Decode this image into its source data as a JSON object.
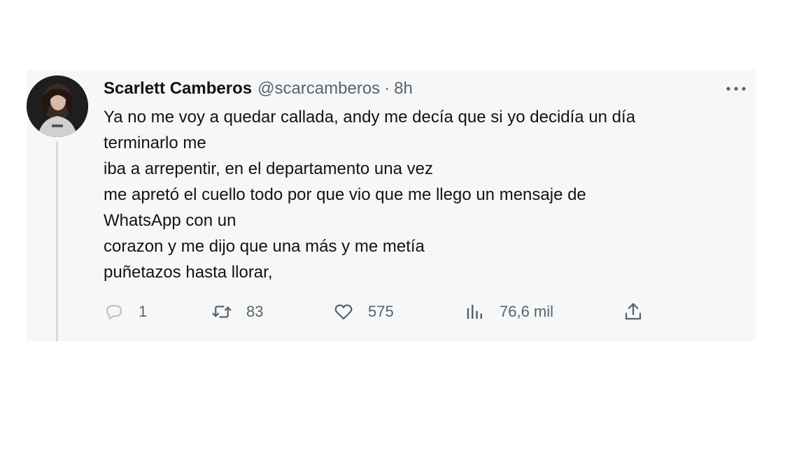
{
  "tweet": {
    "author": {
      "display_name": "Scarlett Camberos",
      "handle": "@scarcamberos",
      "avatar_icon": "profile-photo"
    },
    "separator": "·",
    "time": "8h",
    "more_icon": "more-dots-icon",
    "lines": [
      "Ya no me voy a quedar callada, andy me decía que si yo decidía un día",
      "terminarlo me",
      "iba a arrepentir, en el departamento una vez",
      "me apretó el cuello todo por que vio que me llego un mensaje de",
      "WhatsApp con un",
      "corazon y me dijo que una más y me metía",
      "puñetazos hasta llorar,"
    ],
    "actions": {
      "replies": "1",
      "retweets": "83",
      "likes": "575",
      "views": "76,6 mil",
      "icons": [
        "reply-icon",
        "retweet-icon",
        "like-icon",
        "views-icon",
        "share-icon"
      ]
    }
  },
  "colors": {
    "card_background": "#f7f7f7",
    "primary_text": "#0f1419",
    "secondary_text": "#536471"
  }
}
